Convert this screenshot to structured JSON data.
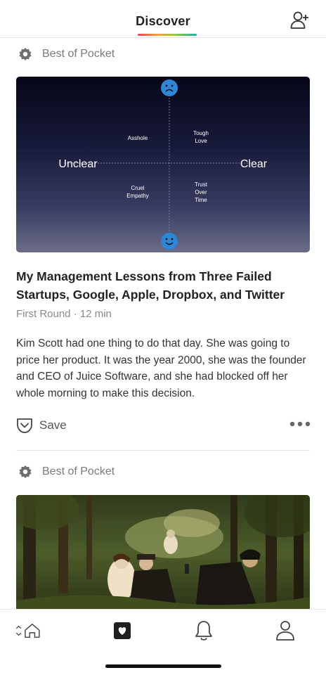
{
  "header": {
    "title": "Discover",
    "add_user_icon": "add-user-icon"
  },
  "feed": [
    {
      "source": "Best of Pocket",
      "image": {
        "center_icon_top": "sad-face-icon",
        "center_icon_bottom": "happy-face-icon",
        "label_left": "Unclear",
        "label_right": "Clear",
        "q1_line1": "Asshole",
        "q2_line1": "Tough",
        "q2_line2": "Love",
        "q3_line1": "Cruel",
        "q3_line2": "Empathy",
        "q4_line1": "Trust",
        "q4_line2": "Over",
        "q4_line3": "Time"
      },
      "title": "My Management Lessons from Three Failed Startups, Google, Apple, Dropbox, and Twitter",
      "meta": "First Round · 12 min",
      "excerpt": "Kim Scott had one thing to do that day. She was going to price her product. It was the year 2000, she was the founder and CEO of Juice Software, and she had blocked off her whole morning to make this decision.",
      "save_label": "Save",
      "more_icon": "more-icon"
    },
    {
      "source": "Best of Pocket",
      "image": "painting-image"
    }
  ],
  "tabbar": {
    "items": [
      "home-icon",
      "saves-icon",
      "notifications-icon",
      "profile-icon"
    ]
  },
  "colors": {
    "accent_gradient": [
      "#ef4056",
      "#f3a73c",
      "#8cc73f",
      "#1cb0a8"
    ],
    "face_blue": "#2d86d6"
  }
}
